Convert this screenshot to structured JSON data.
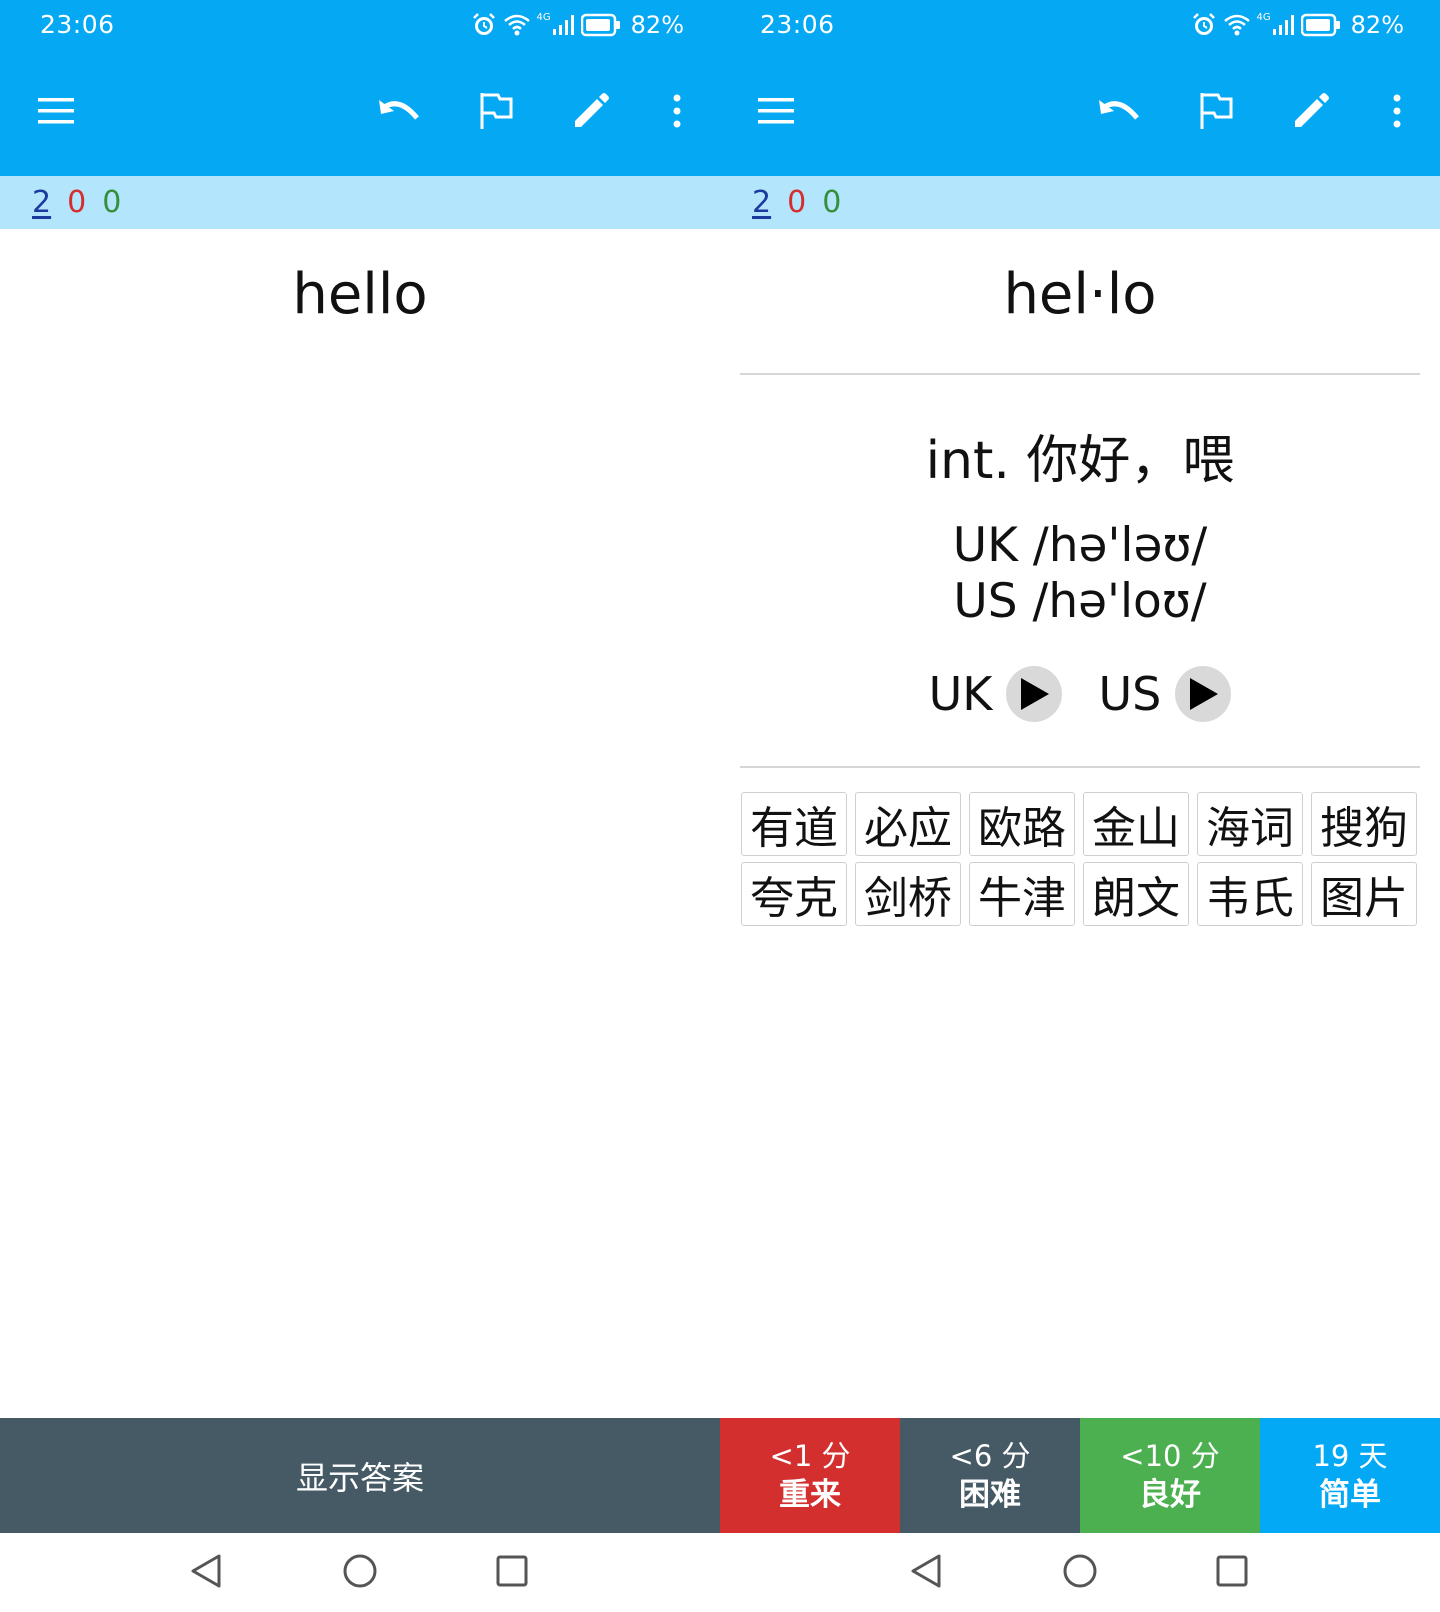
{
  "status": {
    "time": "23:06",
    "network": "4G",
    "battery": "82%",
    "icons": [
      "alarm-icon",
      "wifi-icon",
      "signal-icon",
      "battery-icon"
    ]
  },
  "toolbar": {
    "icons": [
      "menu-icon",
      "undo-icon",
      "flag-icon",
      "edit-icon",
      "more-icon"
    ],
    "color": "#04A8F3"
  },
  "counts": {
    "new": "2",
    "learning": "0",
    "review": "0"
  },
  "question": {
    "word": "hello"
  },
  "answer": {
    "word": "hel·lo",
    "meaning": "int. 你好，喂",
    "phonetic_uk": "UK /hə'ləʊ/",
    "phonetic_us": "US /hə'loʊ/",
    "audio_uk_label": "UK",
    "audio_us_label": "US",
    "dictionaries": [
      [
        "有道",
        "必应",
        "欧路",
        "金山",
        "海词",
        "搜狗"
      ],
      [
        "夸克",
        "剑桥",
        "牛津",
        "朗文",
        "韦氏",
        "图片"
      ]
    ]
  },
  "buttons": {
    "show_answer": "显示答案",
    "again": {
      "interval": "<1 分",
      "label": "重来",
      "color": "#D32F2F"
    },
    "hard": {
      "interval": "<6 分",
      "label": "困难",
      "color": "#455A64"
    },
    "good": {
      "interval": "<10 分",
      "label": "良好",
      "color": "#4CAF50"
    },
    "easy": {
      "interval": "19 天",
      "label": "简单",
      "color": "#03A9F4"
    }
  }
}
